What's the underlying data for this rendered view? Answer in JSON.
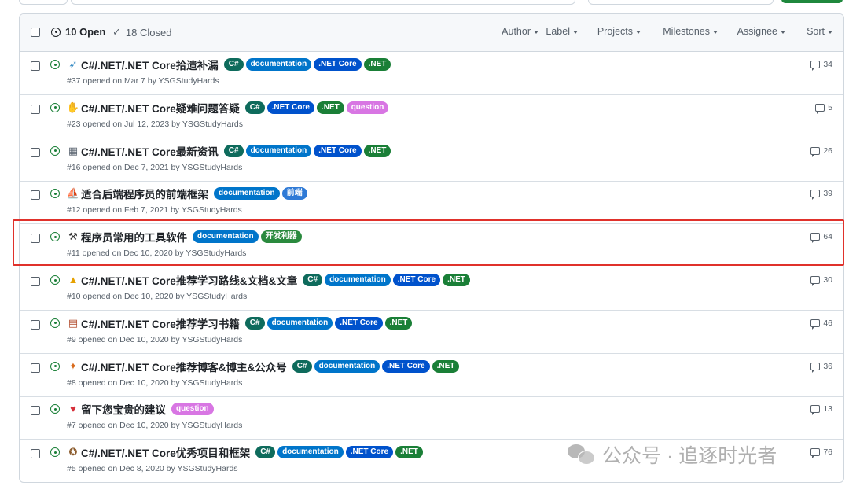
{
  "header": {
    "open_label": "10 Open",
    "closed_label": "18 Closed",
    "filters": [
      "Author",
      "Label",
      "Projects",
      "Milestones",
      "Assignee",
      "Sort"
    ]
  },
  "issues": [
    {
      "emoji": "rocket",
      "title": "C#/.NET/.NET Core拾遗补漏",
      "labels": [
        "C#",
        "documentation",
        ".NET Core",
        ".NET"
      ],
      "meta": "#37 opened on Mar 7 by YSGStudyHards",
      "comments": "34"
    },
    {
      "emoji": "raised-hand",
      "title": "C#/.NET/.NET Core疑难问题答疑",
      "labels": [
        "C#",
        ".NET Core",
        ".NET",
        "question"
      ],
      "meta": "#23 opened on Jul 12, 2023 by YSGStudyHards",
      "comments": "5"
    },
    {
      "emoji": "calendar",
      "title": "C#/.NET/.NET Core最新资讯",
      "labels": [
        "C#",
        "documentation",
        ".NET Core",
        ".NET"
      ],
      "meta": "#16 opened on Dec 7, 2021 by YSGStudyHards",
      "comments": "26"
    },
    {
      "emoji": "sailboat",
      "title": "适合后端程序员的前端框架",
      "labels": [
        "documentation",
        "前端"
      ],
      "meta": "#12 opened on Feb 7, 2021 by YSGStudyHards",
      "comments": "39"
    },
    {
      "emoji": "tools",
      "title": "程序员常用的工具软件",
      "labels": [
        "documentation",
        "开发利器"
      ],
      "meta": "#11 opened on Dec 10, 2020 by YSGStudyHards",
      "comments": "64"
    },
    {
      "emoji": "warning",
      "title": "C#/.NET/.NET Core推荐学习路线&文档&文章",
      "labels": [
        "C#",
        "documentation",
        ".NET Core",
        ".NET"
      ],
      "meta": "#10 opened on Dec 10, 2020 by YSGStudyHards",
      "comments": "30"
    },
    {
      "emoji": "books",
      "title": "C#/.NET/.NET Core推荐学习书籍",
      "labels": [
        "C#",
        "documentation",
        ".NET Core",
        ".NET"
      ],
      "meta": "#9 opened on Dec 10, 2020 by YSGStudyHards",
      "comments": "46"
    },
    {
      "emoji": "fox",
      "title": "C#/.NET/.NET Core推荐博客&博主&公众号",
      "labels": [
        "C#",
        "documentation",
        ".NET Core",
        ".NET"
      ],
      "meta": "#8 opened on Dec 10, 2020 by YSGStudyHards",
      "comments": "36"
    },
    {
      "emoji": "heart",
      "title": "留下您宝贵的建议",
      "labels": [
        "question"
      ],
      "meta": "#7 opened on Dec 10, 2020 by YSGStudyHards",
      "comments": "13"
    },
    {
      "emoji": "medal",
      "title": "C#/.NET/.NET Core优秀项目和框架",
      "labels": [
        "C#",
        "documentation",
        ".NET Core",
        ".NET"
      ],
      "meta": "#5 opened on Dec 8, 2020 by YSGStudyHards",
      "comments": "76"
    }
  ],
  "label_colors": {
    "C#": "#0e6b5c",
    "documentation": "#0075ca",
    ".NET Core": "#0052cc",
    ".NET": "#1a7f37",
    "question": "#d876e3",
    "前端": "#2f7ad6",
    "开发利器": "#2a8a3e"
  },
  "emoji_glyphs": {
    "rocket": {
      "glyph": "➶",
      "color": "#2e86c1",
      "bg": "transparent"
    },
    "raised-hand": {
      "glyph": "✋",
      "color": "#f5b400",
      "bg": "transparent"
    },
    "calendar": {
      "glyph": "▦",
      "color": "#5a6470",
      "bg": "transparent"
    },
    "sailboat": {
      "glyph": "⛵",
      "color": "#c79a00",
      "bg": "transparent"
    },
    "tools": {
      "glyph": "⚒",
      "color": "#333333",
      "bg": "transparent"
    },
    "warning": {
      "glyph": "▲",
      "color": "#e6a100",
      "bg": "transparent"
    },
    "books": {
      "glyph": "▤",
      "color": "#b14a2a",
      "bg": "transparent"
    },
    "fox": {
      "glyph": "✦",
      "color": "#d86a1b",
      "bg": "transparent"
    },
    "heart": {
      "glyph": "♥",
      "color": "#d62f3a",
      "bg": "transparent"
    },
    "medal": {
      "glyph": "✪",
      "color": "#8a5a2b",
      "bg": "transparent"
    }
  },
  "highlighted_issue": "#11",
  "watermark": {
    "text": "公众号 · 追逐时光者"
  }
}
